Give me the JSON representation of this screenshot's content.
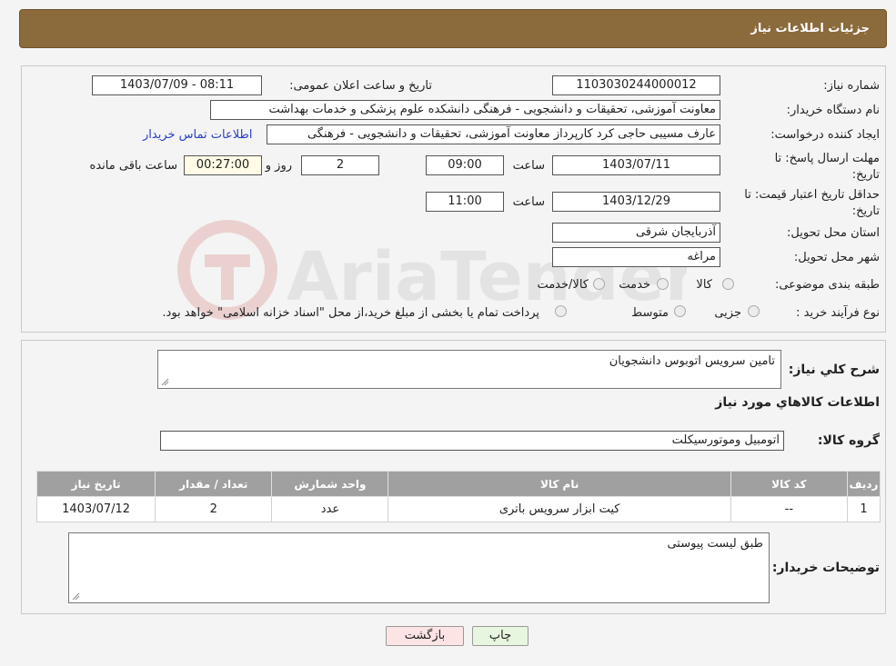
{
  "header": {
    "title": "جزئیات اطلاعات نیاز"
  },
  "form": {
    "need_number_label": "شماره نیاز:",
    "need_number": "1103030244000012",
    "announce_label": "تاریخ و ساعت اعلان عمومی:",
    "announce_value": "1403/07/09 - 08:11",
    "buyer_label": "نام دستگاه خریدار:",
    "buyer_value": "معاونت آموزشی، تحقیقات و دانشجویی - فرهنگی دانشکده علوم پزشکی و خدمات بهداشت",
    "creator_label": "ایجاد کننده درخواست:",
    "creator_value": "عارف مسیبی حاجی کرد کارپرداز معاونت آموزشی، تحقیقات و دانشجویی - فرهنگی",
    "contact_link": "اطلاعات تماس خریدار",
    "deadline_label_1": "مهلت ارسال پاسخ: تا",
    "deadline_label_2": "تاریخ:",
    "deadline_date": "1403/07/11",
    "time_label": "ساعت",
    "deadline_time": "09:00",
    "days_value": "2",
    "days_label": "روز و",
    "remaining_value": "00:27:00",
    "remaining_label": "ساعت باقی مانده",
    "validity_label_1": "حداقل تاریخ اعتبار قیمت: تا",
    "validity_label_2": "تاریخ:",
    "validity_date": "1403/12/29",
    "validity_time": "11:00",
    "province_label": "استان محل تحویل:",
    "province_value": "آذربایجان شرقی",
    "city_label": "شهر محل تحویل:",
    "city_value": "مراغه",
    "category_label": "طبقه بندی موضوعی:",
    "category_options": [
      "کالا",
      "خدمت",
      "کالا/خدمت"
    ],
    "process_label": "نوع فرآیند خرید :",
    "process_options": [
      "جزیی",
      "متوسط"
    ],
    "process_note": "پرداخت تمام یا بخشی از مبلغ خرید،از محل \"اسناد خزانه اسلامی\" خواهد بود."
  },
  "details": {
    "summary_label": "شرح کلي نیاز:",
    "summary_value": "تامین سرویس اتوبوس دانشجویان",
    "goods_info_title": "اطلاعات کالاهاي مورد نیاز",
    "group_label": "گروه کالا:",
    "group_value": "اتومبیل وموتورسیکلت",
    "table": {
      "headers": [
        "ردیف",
        "کد کالا",
        "نام کالا",
        "واحد شمارش",
        "تعداد / مقدار",
        "تاریخ نیاز"
      ],
      "rows": [
        [
          "1",
          "--",
          "کیت ابزار سرویس باتری",
          "عدد",
          "2",
          "1403/07/12"
        ]
      ]
    },
    "buyer_notes_label": "توضیحات خریدار:",
    "buyer_notes_value": "طبق لیست پیوستی"
  },
  "buttons": {
    "print": "چاپ",
    "back": "بازگشت"
  },
  "watermark": "AriaTender.neT",
  "colors": {
    "header": "#8b6a3c",
    "link": "#2a3ec9",
    "table_header": "#a0a0a0",
    "back_button": "#fde4e4",
    "print_button": "#e7f7df"
  }
}
